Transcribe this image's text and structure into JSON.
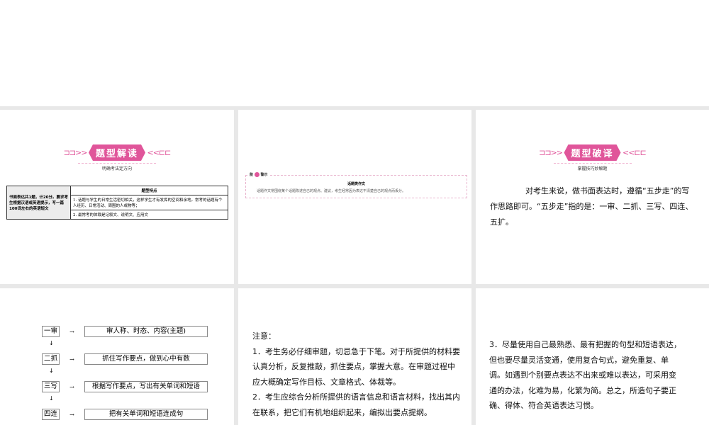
{
  "slide1": {
    "banner_title": "题型解读",
    "banner_sub": "明确考法定方向",
    "table": {
      "left": "书面表达共1题，计20分。要求考生根据汉语或英语提示，写一篇100词左右的英语短文",
      "header": "题型特点",
      "item1": "1. 话题与学生的日常生活密切相关，这样学生才有发挥的空间和余地。常考的话题有个人经历、日常活动、周围的人或物等；",
      "item2": "2. 最常考的体裁是记叙文、说明文、应用文"
    }
  },
  "slide2": {
    "label_pre": "能",
    "label_post": "警示",
    "title": "话题类作文",
    "body": "话题作文常围绕某个话题陈述自己的观点、建议，考生经常因为表达不清楚自己的观点而丢分。"
  },
  "slide3": {
    "banner_title": "题型破译",
    "banner_sub": "掌握技巧妙解题",
    "text": "对考生来说，做书面表达时，遵循“五步走”的写作思路即可。“五步走”指的是：一审、二抓、三写、四连、五扩。"
  },
  "slide4": {
    "steps": [
      {
        "step": "一审",
        "desc": "审人称、时态、内容(主题)"
      },
      {
        "step": "二抓",
        "desc": "抓住写作要点，做到心中有数"
      },
      {
        "step": "三写",
        "desc": "根据写作要点，写出有关单词和短语"
      },
      {
        "step": "四连",
        "desc": "把有关单词和短语连成句"
      }
    ]
  },
  "slide5": {
    "heading": "注意：",
    "p1": "1．考生务必仔细审题，切忌急于下笔。对于所提供的材料要认真分析，反复推敲，抓住要点，掌握大意。在审题过程中应大概确定写作目标、文章格式、体裁等。",
    "p2": "2．考生应综合分析所提供的语言信息和语言材料，找出其内在联系，把它们有机地组织起来，编拟出要点提纲。"
  },
  "slide6": {
    "p3": "3．尽量使用自己最熟悉、最有把握的句型和短语表达，但也要尽量灵活变通，使用复合句式，避免重复、单调。如遇到个别要点表达不出来或难以表达，可采用变通的办法，化难为易，化繁为简。总之，所造句子要正确、得体、符合英语表达习惯。"
  }
}
